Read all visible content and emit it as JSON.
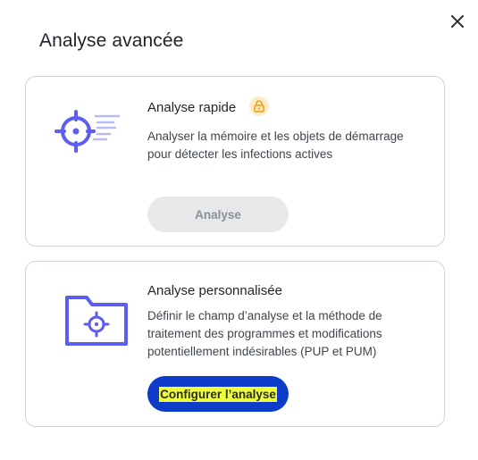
{
  "dialog": {
    "title": "Analyse avancée"
  },
  "quick_scan": {
    "title": "Analyse rapide",
    "description": "Analyser la mémoire et les objets de démarrage pour détecter les infections actives",
    "button_label": "Analyse",
    "icon": "crosshair-speed-icon",
    "badge_icon": "lock-icon"
  },
  "custom_scan": {
    "title": "Analyse personnalisée",
    "description": "Définir le champ d’analyse et la méthode de traitement des programmes et modifications potentiellement indésirables (PUP et PUM)",
    "button_label": "Configurer l’analyse",
    "icon": "folder-crosshair-icon"
  },
  "colors": {
    "accent_blue": "#5b5ef0",
    "primary_button": "#0d3cc9",
    "lock_orange": "#f29d12"
  }
}
